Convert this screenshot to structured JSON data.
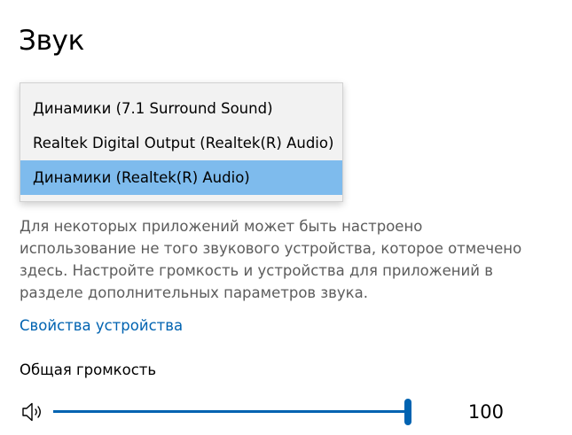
{
  "page": {
    "title": "Звук"
  },
  "output_device_dropdown": {
    "items": [
      {
        "label": "Динамики (7.1 Surround Sound)",
        "selected": false
      },
      {
        "label": "Realtek Digital Output (Realtek(R) Audio)",
        "selected": false
      },
      {
        "label": "Динамики (Realtek(R) Audio)",
        "selected": true
      }
    ],
    "highlight_color": "#7ebbed"
  },
  "description": {
    "lines": [
      "Для некоторых приложений может быть настроено",
      "использование не того звукового устройства, которое отмечено",
      "здесь. Настройте громкость и устройства для приложений в",
      "разделе дополнительных параметров звука."
    ]
  },
  "device_properties_link": {
    "label": "Свойства устройства",
    "color": "#0063b1"
  },
  "master_volume": {
    "label": "Общая громкость",
    "value": "100",
    "level_percent": 100,
    "icon": "speaker-icon",
    "accent_color": "#0063b1"
  }
}
